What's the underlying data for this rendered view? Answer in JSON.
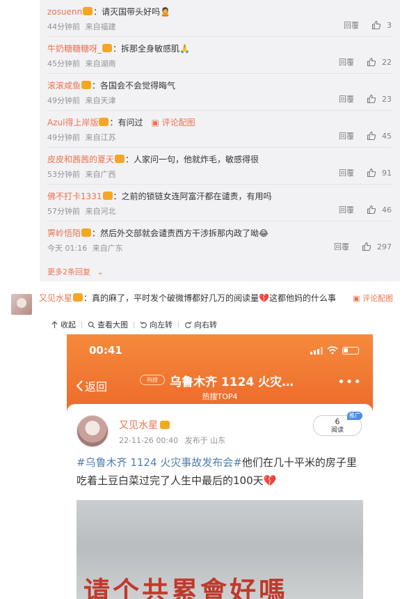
{
  "replies": [
    {
      "user": "zosuenn",
      "text": "：请灭国带头好吗",
      "emoji": "🙎",
      "time": "44分钟前",
      "source": "来自福建",
      "reply_label": "回覆",
      "likes": "3"
    },
    {
      "user": "牛奶糖糖糖呀_",
      "text": "：拆那全身敏感肌",
      "emoji": "🙏",
      "time": "45分钟前",
      "source": "来自湖南",
      "reply_label": "回覆",
      "likes": "22"
    },
    {
      "user": "滚滚咸鱼",
      "text": "：各国会不会觉得晦气",
      "emoji": "",
      "time": "49分钟前",
      "source": "来自天津",
      "reply_label": "回覆",
      "likes": "23"
    },
    {
      "user": "Azul得上岸版",
      "text": "：有问过",
      "emoji": "",
      "pic_link": "评论配图",
      "time": "49分钟前",
      "source": "来自江苏",
      "reply_label": "回覆",
      "likes": "45"
    },
    {
      "user": "皮皮和茜茜的夏天",
      "text": "：人家问一句，他就炸毛，敏感得很",
      "emoji": "",
      "time": "53分钟前",
      "source": "来自广西",
      "reply_label": "回覆",
      "likes": "91"
    },
    {
      "user": "佛不打卡1331",
      "text": "：之前的锁链女连阿富汗都在谴责，有用吗",
      "emoji": "",
      "time": "57分钟前",
      "source": "来自河北",
      "reply_label": "回覆",
      "likes": "46"
    },
    {
      "user": "霁岭悟陌",
      "text": "：然后外交部就会谴责西方干涉拆那内政了呦",
      "emoji": "😂",
      "time": "今天 01:16",
      "source": "来自广东",
      "reply_label": "回覆",
      "likes": "297"
    }
  ],
  "more_replies": "更多2条回复",
  "comment": {
    "user": "又见水星",
    "text_a": "：真的麻了，平时发个破微博都好几万的阅读量",
    "text_b": "这都他妈的什么事",
    "pic_link": "评论配图"
  },
  "toolbar": {
    "collapse": "收起",
    "view_large": "查看大图",
    "rotate_left": "向左转",
    "rotate_right": "向右转"
  },
  "phone": {
    "time": "00:41",
    "back": "返回",
    "hot_badge": "热搜",
    "title": "乌鲁木齐 1124 火灾…",
    "subtitle": "热搜TOP4",
    "more": "•••"
  },
  "post": {
    "user": "又见水星",
    "date": "22-11-26 00:40",
    "published_at": "发布于 山东",
    "reads": "6",
    "reads_label": "阅读",
    "promo_tag": "推广",
    "topic": "#乌鲁木齐 1124 火灾事故发布会#",
    "text": "他们在几十平米的房子里吃着土豆白菜过完了人生中最后的100天",
    "photo_text": "请个共累會好嗎"
  },
  "colors": {
    "accent": "#eb7350",
    "link_blue": "#507daf",
    "header_orange": "#ed6a2a",
    "reply_bg": "#f2f2f5"
  }
}
